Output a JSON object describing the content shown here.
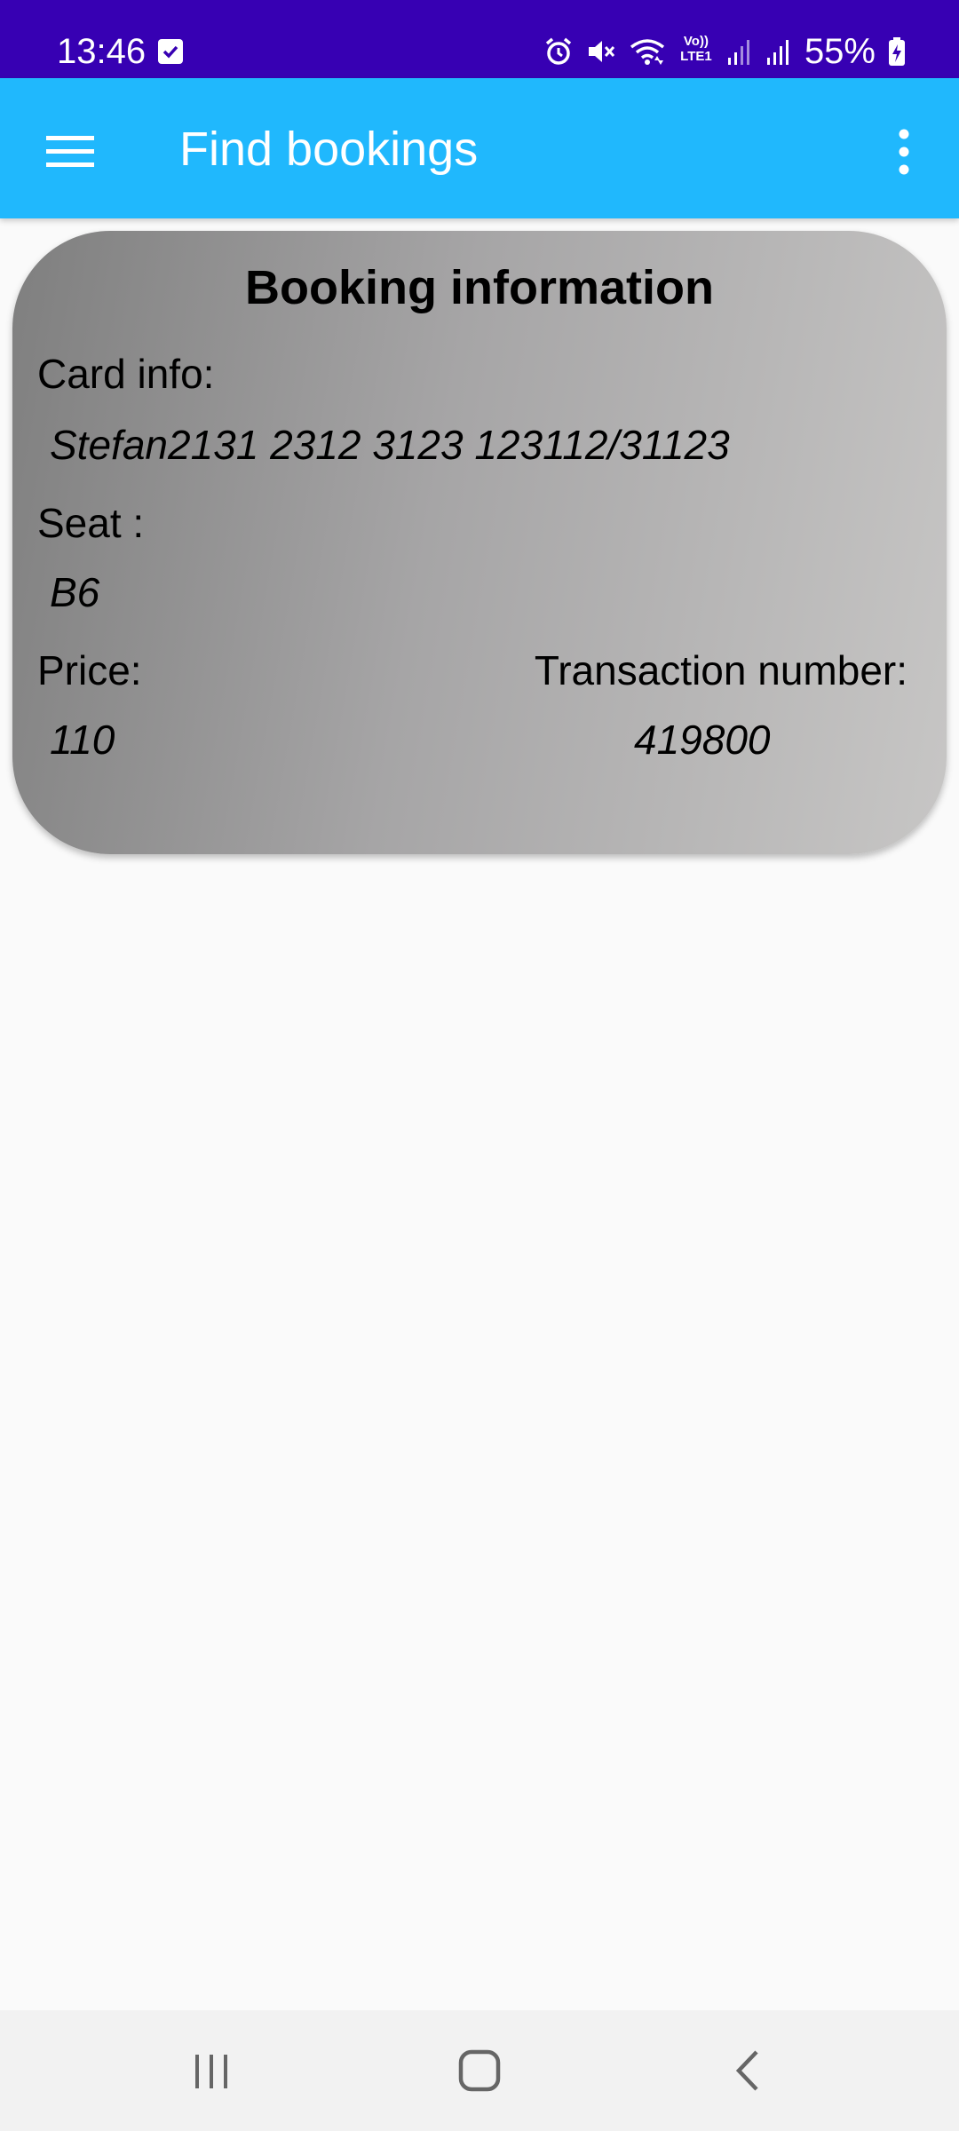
{
  "status_bar": {
    "time": "13:46",
    "battery": "55%",
    "icons": [
      "checkbox-notification-icon",
      "alarm-icon",
      "mute-icon",
      "wifi-icon",
      "volte-icon",
      "signal-icon",
      "signal-icon",
      "battery-charging-icon"
    ],
    "volte_label_top": "Vo))",
    "volte_label_bottom": "LTE1"
  },
  "app_bar": {
    "title": "Find bookings",
    "background": "#20b8fd"
  },
  "booking": {
    "title": "Booking information",
    "card_label": "Card info:",
    "card_value": "Stefan2131 2312 3123 123112/31123",
    "seat_label": "Seat :",
    "seat_value": "B6",
    "price_label": "Price:",
    "price_value": "110",
    "transaction_label": "Transaction number:",
    "transaction_value": "419800"
  },
  "colors": {
    "status_bar": "#3700b3",
    "app_bar": "#20b8fd",
    "background": "#fafafa"
  }
}
